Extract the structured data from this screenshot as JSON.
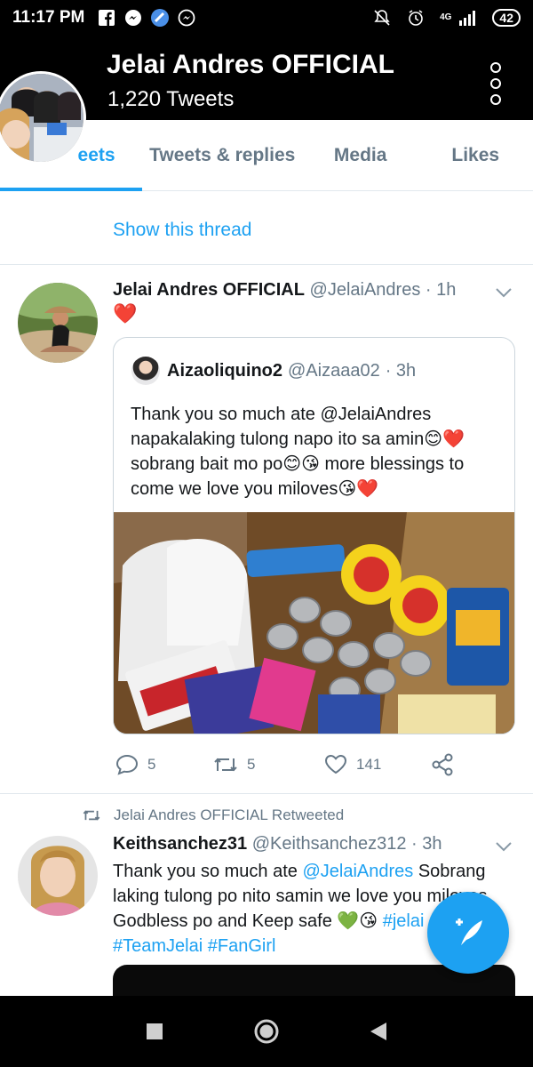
{
  "status_bar": {
    "time": "11:17 PM",
    "network": "4G",
    "battery": "42"
  },
  "header": {
    "title": "Jelai Andres OFFICIAL",
    "tweet_count": "1,220 Tweets"
  },
  "tabs": [
    {
      "label": "Tweets",
      "visible_label": "eets",
      "active": true
    },
    {
      "label": "Tweets & replies",
      "active": false
    },
    {
      "label": "Media",
      "active": false
    },
    {
      "label": "Likes",
      "active": false
    }
  ],
  "show_thread": "Show this thread",
  "tweet1": {
    "name": "Jelai Andres OFFICIAL",
    "handle": "@JelaiAndres",
    "time": "· 1h",
    "text": "❤️",
    "quote": {
      "name": "Aizaoliquino2",
      "handle": "@Aizaaa02",
      "time": "· 3h",
      "text": "Thank you so much ate @JelaiAndres napakalaking tulong napo ito sa amin😊❤️ sobrang bait mo po😊😘 more blessings to come we love you miloves😘❤️"
    },
    "reply_count": "5",
    "retweet_count": "5",
    "like_count": "141"
  },
  "tweet2": {
    "retweeted_by": "Jelai Andres OFFICIAL Retweeted",
    "name": "Keithsanchez31",
    "handle": "@Keithsanchez312",
    "time": "· 3h",
    "text_1": "Thank you so much ate ",
    "mention": "@JelaiAndres",
    "text_2": "  Sobrang laking tulong po nito samin we love you miloves Godbless po and Keep safe 💚😘 ",
    "hashtag_1": "#jelai",
    "hashtag_2": "#TeamJelai",
    "hashtag_3": "#FanGirl"
  },
  "colors": {
    "accent": "#1da1f2",
    "secondary_text": "#657786",
    "like_red": "#e0245e"
  }
}
